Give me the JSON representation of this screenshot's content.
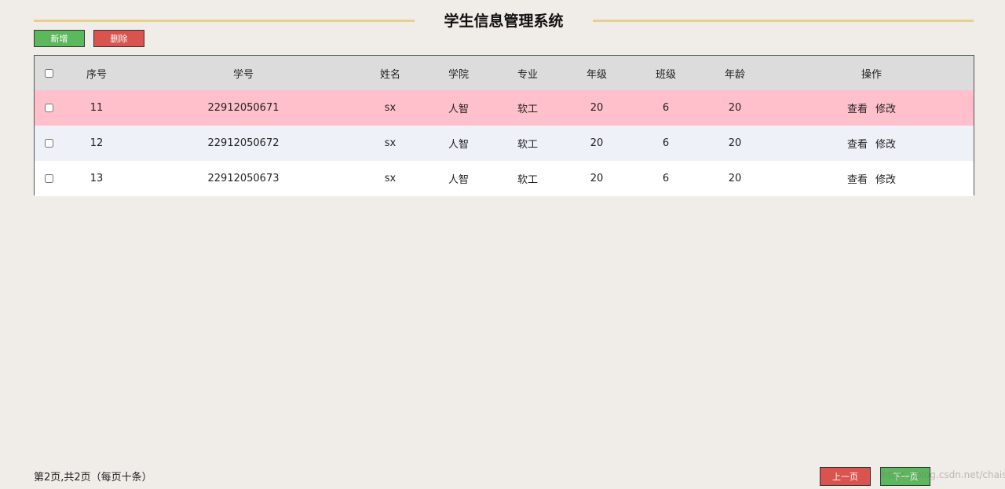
{
  "header": {
    "title": "学生信息管理系统"
  },
  "toolbar": {
    "add_label": "新增",
    "delete_label": "删除"
  },
  "table": {
    "columns": [
      "序号",
      "学号",
      "姓名",
      "学院",
      "专业",
      "年级",
      "班级",
      "年龄",
      "操作"
    ],
    "rows": [
      {
        "id": "11",
        "student_no": "22912050671",
        "name": "sx",
        "college": "人智",
        "major": "软工",
        "grade": "20",
        "class": "6",
        "age": "20",
        "view": "查看",
        "edit": "修改"
      },
      {
        "id": "12",
        "student_no": "22912050672",
        "name": "sx",
        "college": "人智",
        "major": "软工",
        "grade": "20",
        "class": "6",
        "age": "20",
        "view": "查看",
        "edit": "修改"
      },
      {
        "id": "13",
        "student_no": "22912050673",
        "name": "sx",
        "college": "人智",
        "major": "软工",
        "grade": "20",
        "class": "6",
        "age": "20",
        "view": "查看",
        "edit": "修改"
      }
    ]
  },
  "pagination": {
    "info": "第2页,共2页（每页十条）",
    "prev_label": "上一页",
    "next_label": "下一页"
  },
  "watermark": "https://blog.csdn.net/chaisns",
  "colors": {
    "accent_line": "#e8cf8f",
    "green_button": "#5cb85c",
    "red_button": "#d9534f",
    "highlight_row": "#ffc0cb",
    "alt_row": "#eef1f8",
    "header_row": "#dcdcdc"
  }
}
